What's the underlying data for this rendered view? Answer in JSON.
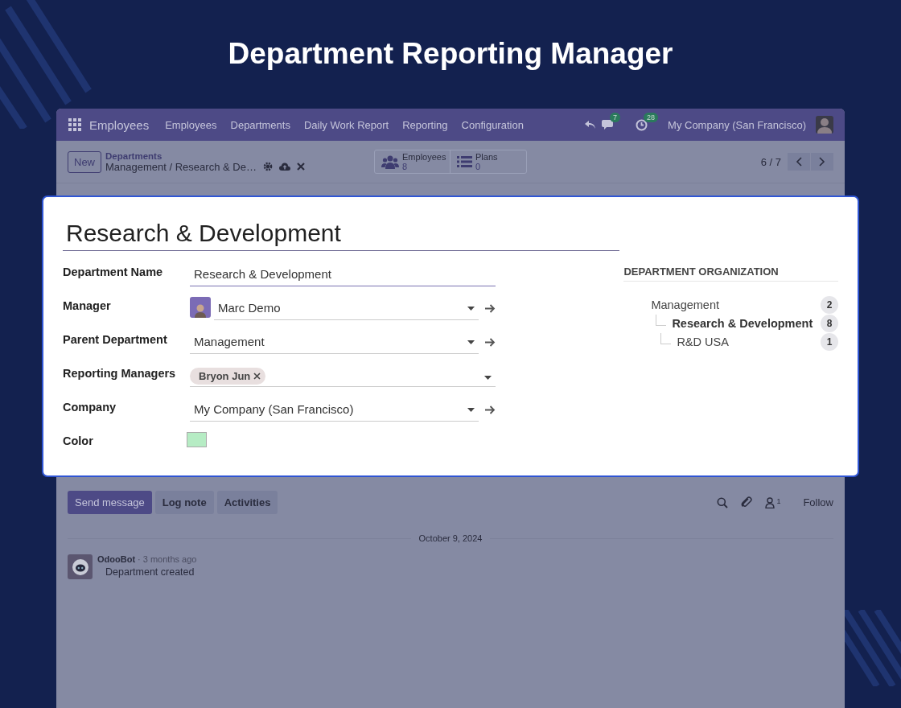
{
  "banner": {
    "title": "Department Reporting Manager"
  },
  "navbar": {
    "app_name": "Employees",
    "menu": [
      "Employees",
      "Departments",
      "Daily Work Report",
      "Reporting",
      "Configuration"
    ],
    "messages_count": "7",
    "activities_count": "28",
    "company": "My Company (San Francisco)"
  },
  "control_panel": {
    "new_button": "New",
    "breadcrumb_parent": "Departments",
    "breadcrumb_current": "Management / Research & De…",
    "smart_buttons": [
      {
        "kind": "people",
        "label": "Employees",
        "count": "8"
      },
      {
        "kind": "list",
        "label": "Plans",
        "count": "0"
      }
    ],
    "pager": "6 / 7"
  },
  "form": {
    "title": "Research & Development",
    "fields": [
      {
        "kind": "text",
        "label": "Department Name",
        "value": "Research & Development"
      },
      {
        "kind": "avatar_link",
        "label": "Manager",
        "value": "Marc Demo"
      },
      {
        "kind": "link",
        "label": "Parent Department",
        "value": "Management"
      },
      {
        "kind": "tags",
        "label": "Reporting Managers",
        "tags": [
          "Bryon Jun"
        ]
      },
      {
        "kind": "link",
        "label": "Company",
        "value": "My Company (San Francisco)"
      },
      {
        "kind": "color",
        "label": "Color",
        "color": "#b6ecc4"
      }
    ]
  },
  "organization": {
    "title": "DEPARTMENT ORGANIZATION",
    "tree": [
      {
        "name": "Management",
        "count": "2",
        "selected": false,
        "children": [
          {
            "name": "Research & Development",
            "count": "8",
            "selected": true,
            "children": [
              {
                "name": "R&D USA",
                "count": "1",
                "selected": false
              }
            ]
          }
        ]
      }
    ]
  },
  "chatter": {
    "buttons": [
      {
        "label": "Send message",
        "selected": true
      },
      {
        "label": "Log note",
        "selected": false
      },
      {
        "label": "Activities",
        "selected": false
      }
    ],
    "followers_count": "1",
    "follow": "Follow",
    "date": "October 9, 2024",
    "messages": [
      {
        "author": "OdooBot",
        "time": "· 3 months ago",
        "body": "Department created"
      }
    ]
  }
}
